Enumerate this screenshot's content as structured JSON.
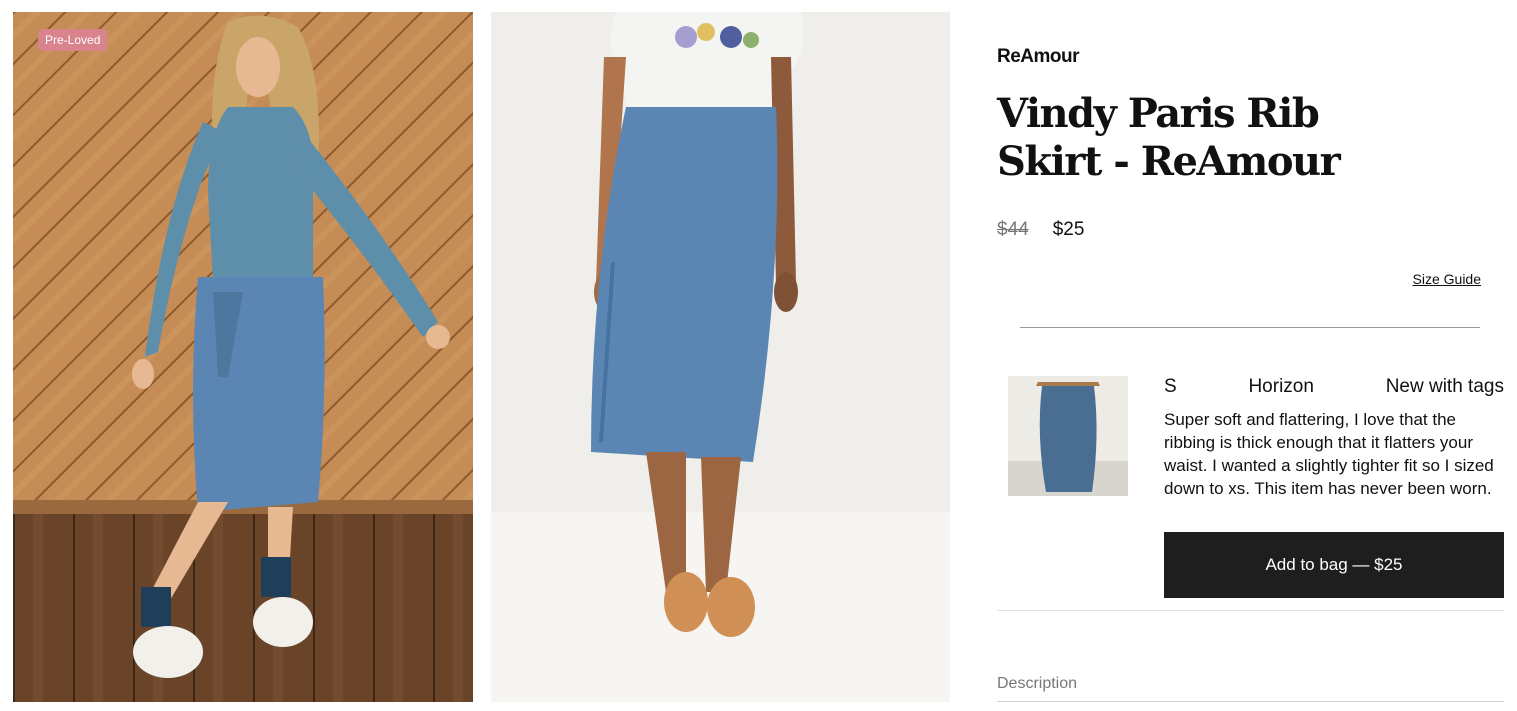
{
  "gallery": {
    "badge": "Pre-Loved",
    "photos": [
      {
        "alt": "Model in blue ribbed skirt and turtleneck on wood background"
      },
      {
        "alt": "Model in blue ribbed midi skirt with white tee"
      }
    ]
  },
  "product": {
    "brand": "ReAmour",
    "title": "Vindy Paris Rib Skirt - ReAmour",
    "price_original": "$44",
    "price_sale": "$25",
    "size_guide_label": "Size Guide"
  },
  "listing": {
    "size": "S",
    "color": "Horizon",
    "condition": "New with tags",
    "description": "Super soft and flattering, I love that the ribbing is thick enough that it flatters your waist. I wanted a slightly tighter fit so I sized down to xs. This item has never been worn.",
    "add_to_bag_label": "Add to bag — $25"
  },
  "sections": {
    "description_heading": "Description"
  },
  "colors": {
    "badge": "#d9838c",
    "button": "#1e1e1e",
    "skirt": "#5b86b4"
  }
}
